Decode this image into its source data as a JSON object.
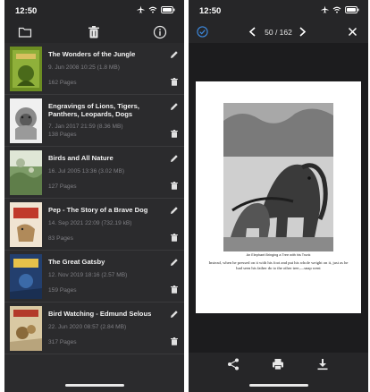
{
  "status": {
    "time": "12:50"
  },
  "library": {
    "toolbar": {
      "left_icon": "folder-icon",
      "center_icon": "trash-icon",
      "right_icon": "info-icon"
    },
    "books": [
      {
        "title": "The Wonders of the Jungle",
        "meta": "9. Jun 2008  10:25  (1.8 MB)",
        "pages": "162 Pages",
        "cover": "#6a8a2a"
      },
      {
        "title": "Engravings of Lions, Tigers, Panthers, Leopards, Dogs",
        "meta": "7. Jan 2017  21:59  (8.36 MB)",
        "pages": "138 Pages",
        "cover": "#8c8c8c"
      },
      {
        "title": "Birds and All Nature",
        "meta": "16. Jul 2005  13:36  (3.02 MB)",
        "pages": "127 Pages",
        "cover": "#7a9a6a"
      },
      {
        "title": "Pep - The Story of a Brave Dog",
        "meta": "14. Sep 2021  22:09  (732.19 kB)",
        "pages": "83 Pages",
        "cover": "#e7d8c4"
      },
      {
        "title": "The Great Gatsby",
        "meta": "12. Nov 2019  18:16  (2.57 MB)",
        "pages": "159 Pages",
        "cover": "#2a4a7a"
      },
      {
        "title": "Bird Watching - Edmund Selous",
        "meta": "22. Jun 2020  08:57  (2.84 MB)",
        "pages": "317 Pages",
        "cover": "#d7c7a0"
      }
    ]
  },
  "reader": {
    "page_indicator": "50 / 162",
    "caption": "An Elephant Bringing a Tree with his Trunk",
    "page_text": "Instead, when he pressed on it with his foot and put his whole weight on it, just as he had seen his father do to the other tree,—snap went"
  }
}
